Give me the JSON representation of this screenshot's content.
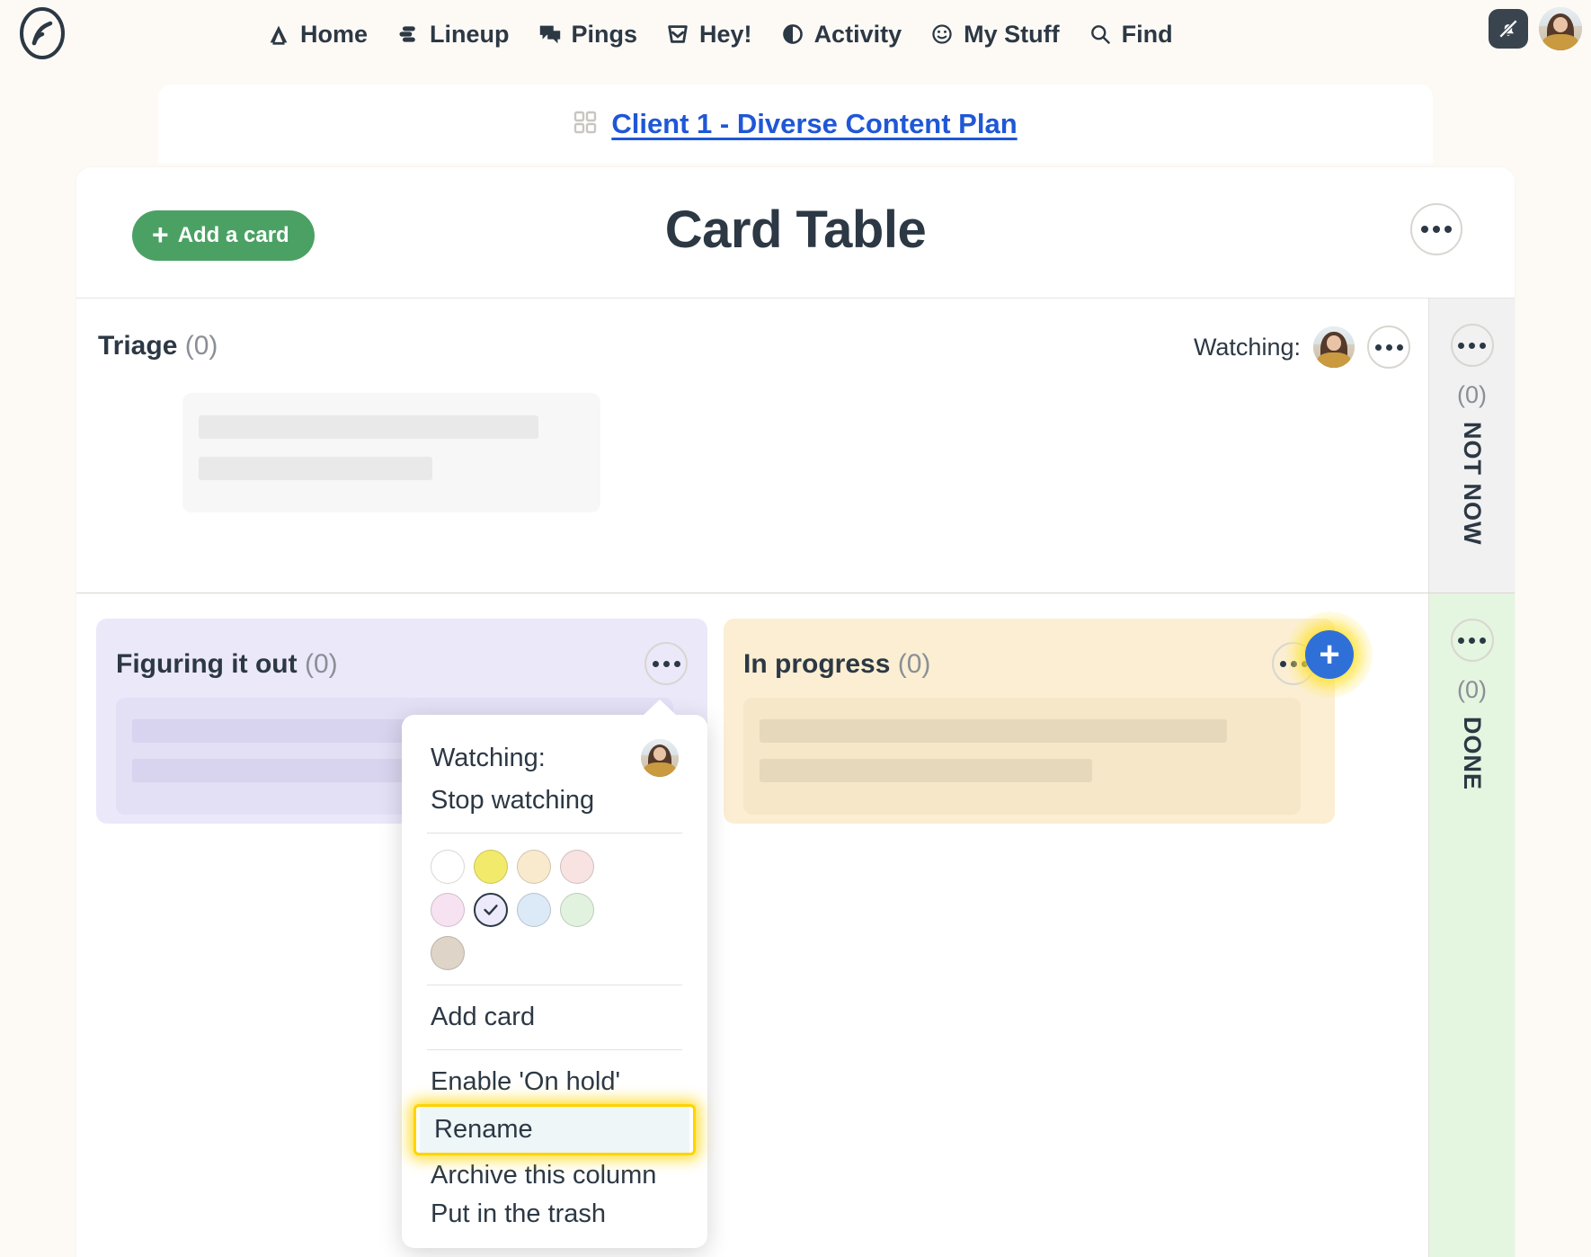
{
  "topnav": {
    "logo_icon": "basecamp-logo-icon",
    "items": [
      {
        "label": "Home",
        "icon": "home-icon"
      },
      {
        "label": "Lineup",
        "icon": "lineup-icon"
      },
      {
        "label": "Pings",
        "icon": "pings-icon"
      },
      {
        "label": "Hey!",
        "icon": "hey-inbox-icon"
      },
      {
        "label": "Activity",
        "icon": "activity-icon"
      },
      {
        "label": "My Stuff",
        "icon": "my-stuff-smiley-icon"
      },
      {
        "label": "Find",
        "icon": "search-icon"
      }
    ],
    "notifications_icon": "bell-slash-icon",
    "avatar_name": "user-avatar"
  },
  "breadcrumb": {
    "icon": "grid-squares-icon",
    "label": "Client 1 - Diverse Content Plan",
    "link_color": "#1f57d6"
  },
  "board": {
    "title": "Card Table",
    "add_card_label": "Add a card",
    "add_card_plus": "+",
    "add_card_color": "#4ba163",
    "menu_icon": "ellipsis-icon"
  },
  "triage": {
    "title": "Triage",
    "count": "(0)",
    "watching_label": "Watching:",
    "menu_icon": "ellipsis-icon"
  },
  "side_columns": [
    {
      "label": "NOT NOW",
      "count": "(0)",
      "bg": "#f1f1f2",
      "menu_icon": "ellipsis-icon"
    },
    {
      "label": "DONE",
      "count": "(0)",
      "bg": "#e4f5e0",
      "menu_icon": "ellipsis-icon"
    }
  ],
  "columns": [
    {
      "title": "Figuring it out",
      "count": "(0)",
      "bg": "#ebe8fa",
      "menu_icon": "ellipsis-icon"
    },
    {
      "title": "In progress",
      "count": "(0)",
      "bg": "#fbeed2",
      "menu_icon": "ellipsis-icon"
    }
  ],
  "add_column_button": {
    "label": "+",
    "color": "#2f6fd8",
    "highlight_color": "#ffd400"
  },
  "column_menu": {
    "watching_label": "Watching:",
    "stop_watching_label": "Stop watching",
    "swatches": [
      {
        "name": "white",
        "hex": "#ffffff",
        "selected": false
      },
      {
        "name": "yellow",
        "hex": "#f2ea6a",
        "selected": false
      },
      {
        "name": "peach",
        "hex": "#faeacd",
        "selected": false
      },
      {
        "name": "pink",
        "hex": "#f8e2e2",
        "selected": false
      },
      {
        "name": "violet",
        "hex": "#f7e2f2",
        "selected": false
      },
      {
        "name": "lavender-selected",
        "hex": "#eceafb",
        "selected": true
      },
      {
        "name": "blue",
        "hex": "#dce9f6",
        "selected": false
      },
      {
        "name": "green",
        "hex": "#e1f3df",
        "selected": false
      },
      {
        "name": "taupe",
        "hex": "#ded4c8",
        "selected": false
      }
    ],
    "add_card_label": "Add card",
    "enable_on_hold_label": "Enable 'On hold'",
    "rename_label": "Rename",
    "archive_label": "Archive this column",
    "trash_label": "Put in the trash",
    "highlighted_item": "Rename"
  }
}
